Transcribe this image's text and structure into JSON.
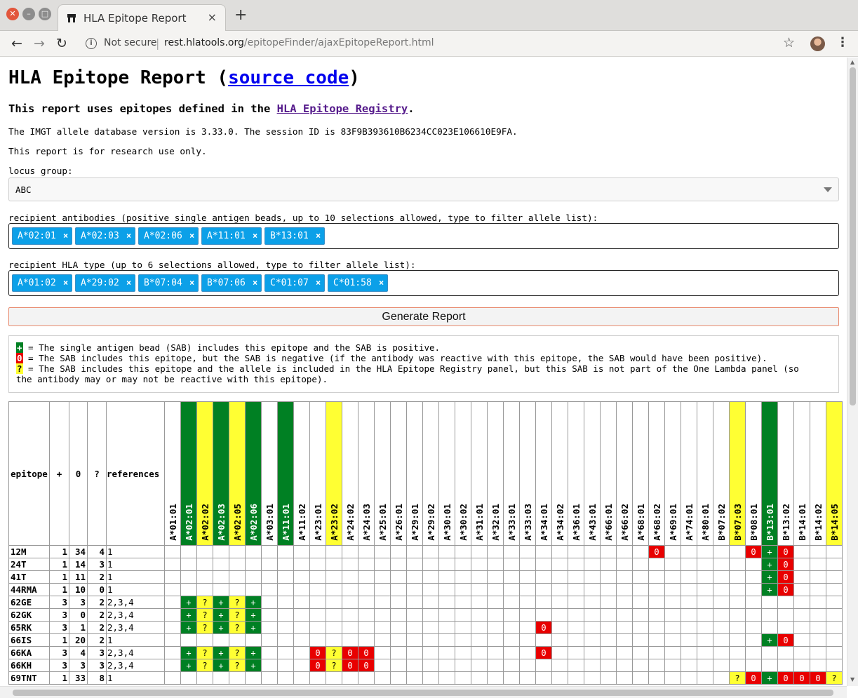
{
  "browser": {
    "tab_title": "HLA Epitope Report",
    "tab_close": "×",
    "new_tab": "+",
    "security": "Not secure",
    "url_host": "rest.hlatools.org",
    "url_path": "/epitopeFinder/ajaxEpitopeReport.html"
  },
  "page": {
    "title": "HLA Epitope Report (",
    "title_link": "source code",
    "title_end": ")",
    "subtitle": "This report uses epitopes defined in the ",
    "subtitle_link": "HLA Epitope Registry",
    "subtitle_end": ".",
    "db_info": "The IMGT allele database version is 3.33.0. The session ID is 83F9B393610B6234CC023E106610E9FA.",
    "research_note": "This report is for research use only.",
    "locus_label": "locus group:",
    "locus_value": "ABC",
    "antibodies_label": "recipient antibodies (positive single antigen beads, up to 10 selections allowed, type to filter allele list):",
    "antibodies": [
      "A*02:01",
      "A*02:03",
      "A*02:06",
      "A*11:01",
      "B*13:01"
    ],
    "hla_label": "recipient HLA type (up to 6 selections allowed, type to filter allele list):",
    "hla_types": [
      "A*01:02",
      "A*29:02",
      "B*07:04",
      "B*07:06",
      "C*01:07",
      "C*01:58"
    ],
    "chip_remove": "×",
    "generate_button": "Generate Report",
    "legend": {
      "plus": "+",
      "zero": "0",
      "question": "?",
      "plus_text": " = The single antigen bead (SAB) includes this epitope and the SAB is positive.",
      "zero_text": " = The SAB includes this epitope, but the SAB is negative (if the antibody was reactive with this epitope, the SAB would have been positive).",
      "question_text": " = The SAB includes this epitope and the allele is included in the HLA Epitope Registry panel, but this SAB is not part of the One Lambda panel (so",
      "question_text2": "the antibody may or may not be reactive with this epitope)."
    }
  },
  "table": {
    "headers": [
      "epitope",
      "+",
      "0",
      "?",
      "references"
    ],
    "alleles": [
      "A*01:01",
      "A*02:01",
      "A*02:02",
      "A*02:03",
      "A*02:05",
      "A*02:06",
      "A*03:01",
      "A*11:01",
      "A*11:02",
      "A*23:01",
      "A*23:02",
      "A*24:02",
      "A*24:03",
      "A*25:01",
      "A*26:01",
      "A*29:01",
      "A*29:02",
      "A*30:01",
      "A*30:02",
      "A*31:01",
      "A*32:01",
      "A*33:01",
      "A*33:03",
      "A*34:01",
      "A*34:02",
      "A*36:01",
      "A*43:01",
      "A*66:01",
      "A*66:02",
      "A*68:01",
      "A*68:02",
      "A*69:01",
      "A*74:01",
      "A*80:01",
      "B*07:02",
      "B*07:03",
      "B*08:01",
      "B*13:01",
      "B*13:02",
      "B*14:01",
      "B*14:02",
      "B*14:05"
    ],
    "allele_colors": [
      "",
      "g",
      "y",
      "g",
      "y",
      "g",
      "",
      "g",
      "",
      "",
      "y",
      "",
      "",
      "",
      "",
      "",
      "",
      "",
      "",
      "",
      "",
      "",
      "",
      "",
      "",
      "",
      "",
      "",
      "",
      "",
      "",
      "",
      "",
      "",
      "",
      "y",
      "",
      "g",
      "",
      "",
      "",
      "y"
    ],
    "rows": [
      {
        "epitope": "12M",
        "plus": "1",
        "zero": "34",
        "q": "4",
        "refs": "1",
        "cells": {
          "30": "0",
          "36": "0",
          "37": "+",
          "38": "0"
        }
      },
      {
        "epitope": "24T",
        "plus": "1",
        "zero": "14",
        "q": "3",
        "refs": "1",
        "cells": {
          "37": "+",
          "38": "0"
        }
      },
      {
        "epitope": "41T",
        "plus": "1",
        "zero": "11",
        "q": "2",
        "refs": "1",
        "cells": {
          "37": "+",
          "38": "0"
        }
      },
      {
        "epitope": "44RMA",
        "plus": "1",
        "zero": "10",
        "q": "0",
        "refs": "1",
        "cells": {
          "37": "+",
          "38": "0"
        }
      },
      {
        "epitope": "62GE",
        "plus": "3",
        "zero": "3",
        "q": "2",
        "refs": "2,3,4",
        "cells": {
          "1": "+",
          "2": "?",
          "3": "+",
          "4": "?",
          "5": "+"
        }
      },
      {
        "epitope": "62GK",
        "plus": "3",
        "zero": "0",
        "q": "2",
        "refs": "2,3,4",
        "cells": {
          "1": "+",
          "2": "?",
          "3": "+",
          "4": "?",
          "5": "+"
        }
      },
      {
        "epitope": "65RK",
        "plus": "3",
        "zero": "1",
        "q": "2",
        "refs": "2,3,4",
        "cells": {
          "1": "+",
          "2": "?",
          "3": "+",
          "4": "?",
          "5": "+",
          "23": "0"
        }
      },
      {
        "epitope": "66IS",
        "plus": "1",
        "zero": "20",
        "q": "2",
        "refs": "1",
        "cells": {
          "37": "+",
          "38": "0"
        }
      },
      {
        "epitope": "66KA",
        "plus": "3",
        "zero": "4",
        "q": "3",
        "refs": "2,3,4",
        "cells": {
          "1": "+",
          "2": "?",
          "3": "+",
          "4": "?",
          "5": "+",
          "9": "0",
          "10": "?",
          "11": "0",
          "12": "0",
          "23": "0"
        }
      },
      {
        "epitope": "66KH",
        "plus": "3",
        "zero": "3",
        "q": "3",
        "refs": "2,3,4",
        "cells": {
          "1": "+",
          "2": "?",
          "3": "+",
          "4": "?",
          "5": "+",
          "9": "0",
          "10": "?",
          "11": "0",
          "12": "0"
        }
      },
      {
        "epitope": "69TNT",
        "plus": "1",
        "zero": "33",
        "q": "8",
        "refs": "1",
        "cells": {
          "35": "?",
          "36": "0",
          "37": "+",
          "38": "0",
          "39": "0",
          "40": "0",
          "41": "?"
        }
      }
    ]
  },
  "colors": {
    "positive": "#008023",
    "negative": "#e80000",
    "unknown": "#ffff33",
    "chip": "#0ca0e8",
    "link": "#0000ee"
  },
  "icons": [
    "close-icon",
    "minimize-icon",
    "maximize-icon",
    "favicon-icon",
    "back-arrow-icon",
    "forward-arrow-icon",
    "reload-icon",
    "info-icon",
    "star-icon",
    "kebab-menu-icon",
    "dropdown-caret-icon"
  ]
}
